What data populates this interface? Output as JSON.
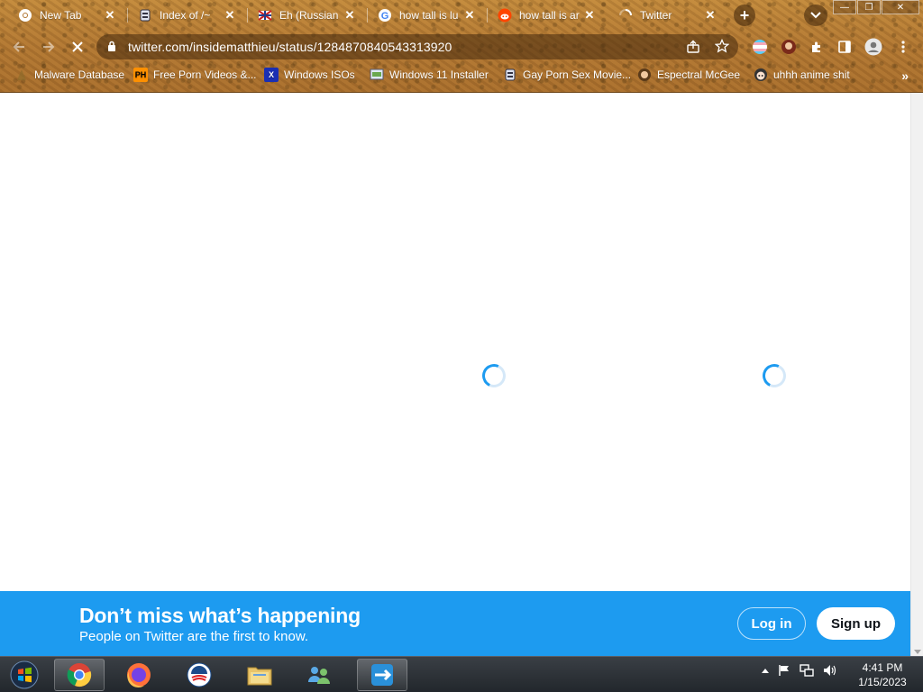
{
  "browser": {
    "tabs": [
      {
        "title": "New Tab",
        "icon": "chrome-icon"
      },
      {
        "title": "Index of /~",
        "icon": "server-icon"
      },
      {
        "title": "Eh (Russian",
        "icon": "flag-icon"
      },
      {
        "title": "how tall is lu",
        "icon": "google-icon"
      },
      {
        "title": "how tall is ar",
        "icon": "reddit-icon"
      },
      {
        "title": "Twitter",
        "icon": "loading-icon"
      }
    ],
    "url": "twitter.com/insidematthieu/status/1284870840543313920",
    "bookmarks": [
      {
        "label": "Malware Database",
        "icon": "bookmark-icon"
      },
      {
        "label": "Free Porn Videos &...",
        "icon": "ph-icon",
        "badge": "PH"
      },
      {
        "label": "Windows ISOs",
        "icon": "x-icon",
        "badge": "X"
      },
      {
        "label": "Windows 11 Installer",
        "icon": "installer-icon"
      },
      {
        "label": "Gay Porn Sex Movie...",
        "icon": "server-icon"
      },
      {
        "label": "Espectral McGee",
        "icon": "avatar-icon"
      },
      {
        "label": "uhhh anime shit",
        "icon": "anime-icon"
      }
    ],
    "accent_color": "#b17631"
  },
  "page": {
    "banner": {
      "headline": "Don’t miss what’s happening",
      "subtext": "People on Twitter are the first to know.",
      "login_label": "Log in",
      "signup_label": "Sign up",
      "color": "#1d9bf0"
    }
  },
  "taskbar": {
    "time": "4:41 PM",
    "date": "1/15/2023",
    "apps": [
      "chrome-icon",
      "firefox-icon",
      "obama-logo-icon",
      "file-explorer-icon",
      "network-people-icon",
      "teamviewer-icon"
    ]
  }
}
